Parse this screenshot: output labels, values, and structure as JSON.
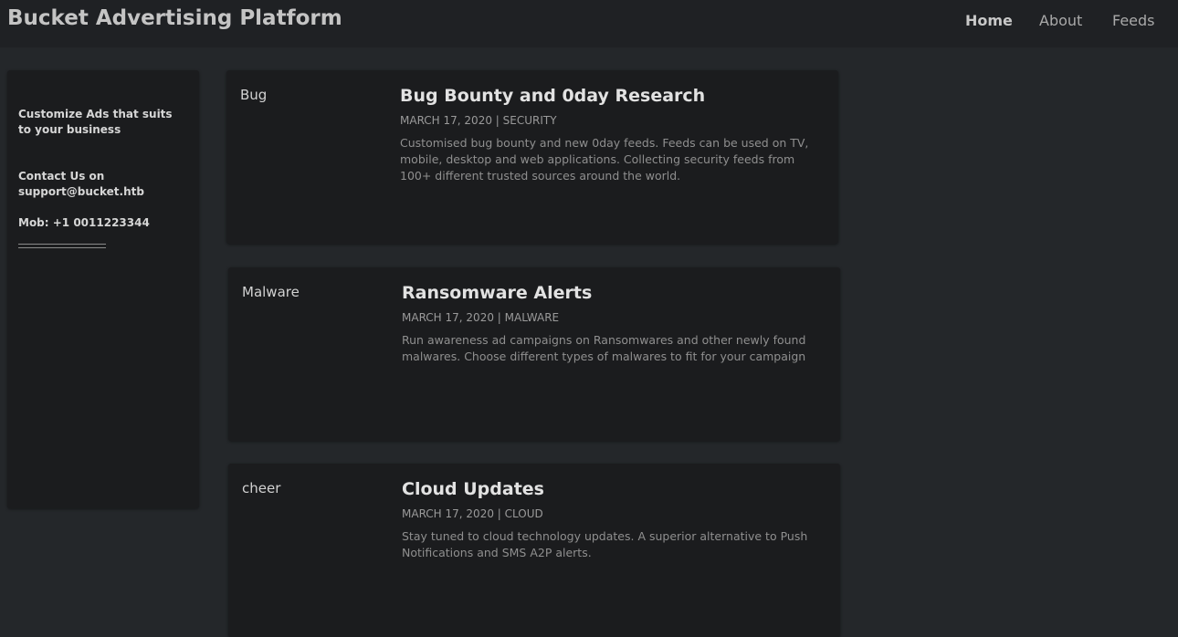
{
  "header": {
    "title": "Bucket Advertising Platform",
    "nav": [
      {
        "label": "Home",
        "active": true
      },
      {
        "label": "About",
        "active": false
      },
      {
        "label": "Feeds",
        "active": false
      }
    ]
  },
  "sidebar": {
    "tagline": "Customize Ads that suits to your business",
    "contact": "Contact Us on support@bucket.htb",
    "mobile": "Mob: +1 0011223344"
  },
  "posts": [
    {
      "tag": "Bug",
      "title": "Bug Bounty and 0day Research",
      "meta": "MARCH 17, 2020 | SECURITY",
      "description": "Customised bug bounty and new 0day feeds. Feeds can be used on TV, mobile, desktop and web applications. Collecting security feeds from 100+ different trusted sources around the world."
    },
    {
      "tag": "Malware",
      "title": "Ransomware Alerts",
      "meta": "MARCH 17, 2020 | MALWARE",
      "description": "Run awareness ad campaigns on Ransomwares and other newly found malwares. Choose different types of malwares to fit for your campaign"
    },
    {
      "tag": "cheer",
      "title": "Cloud Updates",
      "meta": "MARCH 17, 2020 | CLOUD",
      "description": "Stay tuned to cloud technology updates. A superior alternative to Push Notifications and SMS A2P alerts."
    }
  ],
  "colors": {
    "background": "#24272a",
    "header": "#1f2124",
    "card": "#1b1c1e"
  }
}
